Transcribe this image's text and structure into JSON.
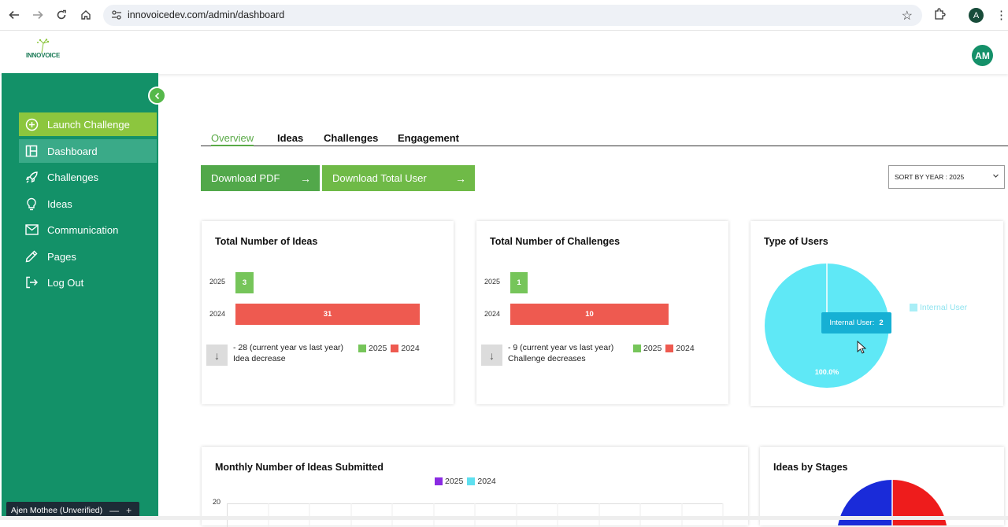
{
  "browser": {
    "url": "innovoicedev.com/admin/dashboard",
    "profile_initial": "A"
  },
  "header": {
    "logo_text": "INNOVOICE",
    "avatar_initials": "AM"
  },
  "sidebar": {
    "items": [
      {
        "label": "Launch Challenge",
        "icon": "plus-circle-icon"
      },
      {
        "label": "Dashboard",
        "icon": "dashboard-icon"
      },
      {
        "label": "Challenges",
        "icon": "rocket-icon"
      },
      {
        "label": "Ideas",
        "icon": "lightbulb-icon"
      },
      {
        "label": "Communication",
        "icon": "mail-icon"
      },
      {
        "label": "Pages",
        "icon": "pencil-icon"
      },
      {
        "label": "Log Out",
        "icon": "logout-icon"
      }
    ],
    "user_chip": "Ajen Mothee (Unverified)"
  },
  "tabs": [
    "Overview",
    "Ideas",
    "Challenges",
    "Engagement"
  ],
  "actions": {
    "download_pdf": "Download PDF",
    "download_total_user": "Download Total User",
    "sort_select": "SORT BY YEAR : 2025"
  },
  "colors": {
    "sidebar": "#139168",
    "accent_green": "#76c55a",
    "accent_red": "#ee5a50",
    "pie_cyan": "#5fe8f6"
  },
  "cards": {
    "ideas": {
      "title": "Total Number of Ideas",
      "compare_line1": "- 28 (current year vs last year)",
      "compare_line2": "Idea decrease",
      "legend": [
        "2025",
        "2024"
      ]
    },
    "challenges": {
      "title": "Total Number of Challenges",
      "compare_line1": "- 9 (current year vs last year)",
      "compare_line2": "Challenge decreases",
      "legend": [
        "2025",
        "2024"
      ]
    },
    "users": {
      "title": "Type of Users",
      "legend": "Internal User",
      "tooltip_label": "Internal User:",
      "tooltip_value": "2",
      "slice_label": "100.0%"
    },
    "monthly": {
      "title": "Monthly Number of Ideas Submitted",
      "legend": [
        "2025",
        "2024"
      ],
      "y_tick": "20"
    },
    "stages": {
      "title": "Ideas by Stages"
    }
  },
  "chart_data": [
    {
      "type": "bar",
      "title": "Total Number of Ideas",
      "categories": [
        "2025",
        "2024"
      ],
      "values": [
        3,
        31
      ],
      "colors": [
        "#76c55a",
        "#ee5a50"
      ],
      "orientation": "horizontal"
    },
    {
      "type": "bar",
      "title": "Total Number of Challenges",
      "categories": [
        "2025",
        "2024"
      ],
      "values": [
        1,
        10
      ],
      "colors": [
        "#76c55a",
        "#ee5a50"
      ],
      "orientation": "horizontal"
    },
    {
      "type": "pie",
      "title": "Type of Users",
      "categories": [
        "Internal User"
      ],
      "values": [
        2
      ],
      "percent_labels": [
        "100.0%"
      ]
    }
  ]
}
